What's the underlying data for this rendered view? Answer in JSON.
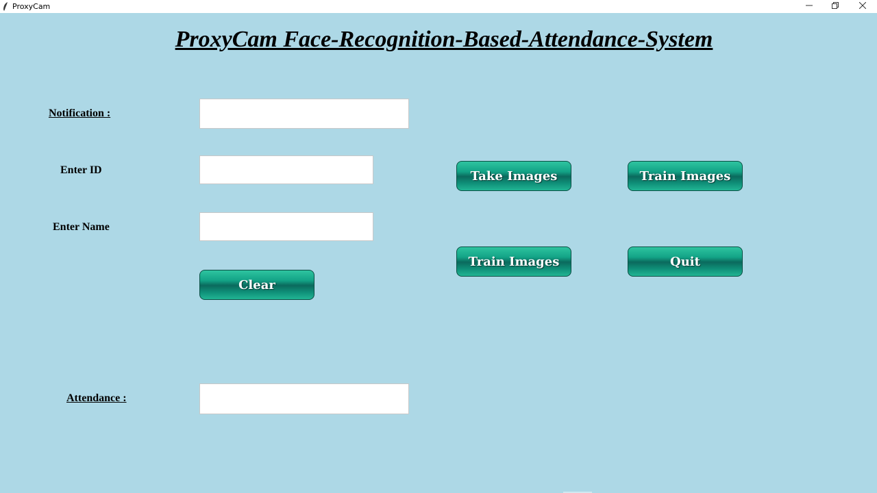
{
  "window": {
    "title": "ProxyCam",
    "controls": {
      "minimize_icon": "minimize-icon",
      "restore_icon": "restore-icon",
      "close_icon": "close-icon"
    }
  },
  "heading": "ProxyCam Face-Recognition-Based-Attendance-System",
  "form": {
    "notification_label": "Notification :",
    "notification_value": "",
    "id_label": "Enter ID",
    "id_value": "",
    "name_label": "Enter Name",
    "name_value": "",
    "clear_label": "Clear",
    "attendance_label": "Attendance :",
    "attendance_value": ""
  },
  "actions": {
    "take_images_label": "Take Images",
    "train_images_top_label": "Train Images",
    "train_images_bottom_label": "Train Images",
    "quit_label": "Quit"
  },
  "colors": {
    "background": "#add8e6",
    "button_teal": "#13a386",
    "button_dark": "#0b6a5d"
  }
}
